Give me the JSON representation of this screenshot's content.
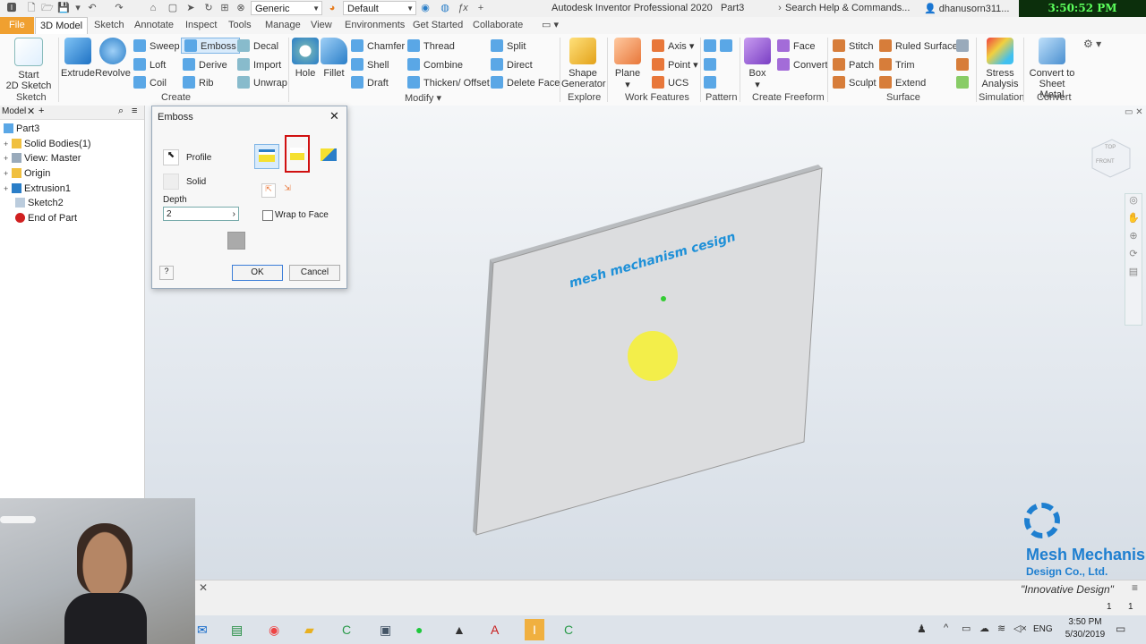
{
  "titlebar": {
    "appearance_combo": "Generic",
    "style_combo": "Default",
    "app_title": "Autodesk Inventor Professional 2020",
    "document": "Part3",
    "help_search": "Search Help & Commands...",
    "user": "dhanusorn311...",
    "clock_overlay": "3:50:52 PM 05/30/2019"
  },
  "tabs": [
    "File",
    "3D Model",
    "Sketch",
    "Annotate",
    "Inspect",
    "Tools",
    "Manage",
    "View",
    "Environments",
    "Get Started",
    "Collaborate"
  ],
  "ribbon": {
    "sketch": {
      "start": "Start",
      "start2": "2D Sketch",
      "group": "Sketch"
    },
    "create": {
      "extrude": "Extrude",
      "revolve": "Revolve",
      "sweep": "Sweep",
      "emboss": "Emboss",
      "decal": "Decal",
      "loft": "Loft",
      "derive": "Derive",
      "import": "Import",
      "coil": "Coil",
      "rib": "Rib",
      "unwrap": "Unwrap",
      "group": "Create"
    },
    "modify": {
      "hole": "Hole",
      "fillet": "Fillet",
      "chamfer": "Chamfer",
      "shell": "Shell",
      "draft": "Draft",
      "thread": "Thread",
      "combine": "Combine",
      "thicken": "Thicken/ Offset",
      "split": "Split",
      "direct": "Direct",
      "delete_face": "Delete Face",
      "group": "Modify"
    },
    "explore": {
      "shape1": "Shape",
      "shape2": "Generator",
      "group": "Explore"
    },
    "work": {
      "plane": "Plane",
      "axis": "Axis",
      "point": "Point",
      "ucs": "UCS",
      "group": "Work Features"
    },
    "pattern": {
      "group": "Pattern"
    },
    "freeform": {
      "box": "Box",
      "face": "Face",
      "convert": "Convert",
      "group": "Create Freeform"
    },
    "surface": {
      "stitch": "Stitch",
      "ruled": "Ruled Surface",
      "patch": "Patch",
      "trim": "Trim",
      "sculpt": "Sculpt",
      "extend": "Extend",
      "group": "Surface"
    },
    "simulation": {
      "stress1": "Stress",
      "stress2": "Analysis",
      "group": "Simulation"
    },
    "convert": {
      "c1": "Convert to",
      "c2": "Sheet Metal",
      "group": "Convert"
    }
  },
  "browser": {
    "tab": "Model",
    "items": [
      "Part3",
      "Solid Bodies(1)",
      "View: Master",
      "Origin",
      "Extrusion1",
      "Sketch2",
      "End of Part"
    ]
  },
  "dialog": {
    "title": "Emboss",
    "profile": "Profile",
    "solid": "Solid",
    "depth_label": "Depth",
    "depth_value": "2",
    "wrap": "Wrap to Face",
    "ok": "OK",
    "cancel": "Cancel"
  },
  "viewport": {
    "emboss_text": "mesh mechanism cesign",
    "viewcube_top": "TOP",
    "viewcube_front": "FRONT"
  },
  "watermark": {
    "line1": "Mesh Mechanism",
    "line2": "Design Co., Ltd.",
    "tagline": "\"Innovative Design\""
  },
  "status": {
    "count1": "1",
    "count2": "1"
  },
  "taskbar": {
    "lang": "ENG",
    "time": "3:50 PM",
    "date": "5/30/2019"
  },
  "colors": {
    "accent": "#f0a030",
    "highlight_red": "#d01010",
    "text_blue": "#1e90d8",
    "sun": "#f5f03a"
  }
}
